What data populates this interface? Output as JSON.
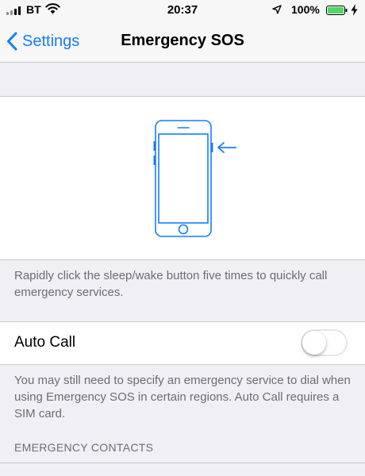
{
  "status_bar": {
    "carrier": "BT",
    "time": "20:37",
    "battery_percent": "100%",
    "battery_level": 1.0,
    "charging": true,
    "icons": [
      "signal-icon",
      "wifi-icon",
      "location-icon",
      "battery-icon",
      "charging-bolt-icon"
    ]
  },
  "nav": {
    "back_label": "Settings",
    "title": "Emergency SOS"
  },
  "illustration": {
    "icon": "phone-side-button-icon",
    "accent_color": "#147efb"
  },
  "description": "Rapidly click the sleep/wake button five times to quickly call emergency services.",
  "auto_call": {
    "label": "Auto Call",
    "enabled": false,
    "footer": "You may still need to specify an emergency service to dial when using Emergency SOS in certain regions. Auto Call requires a SIM card."
  },
  "contacts_section": {
    "header": "EMERGENCY CONTACTS"
  },
  "colors": {
    "accent": "#147efb",
    "background": "#efeff4",
    "secondary_text": "#6d6d72",
    "battery": "#4cd964"
  }
}
